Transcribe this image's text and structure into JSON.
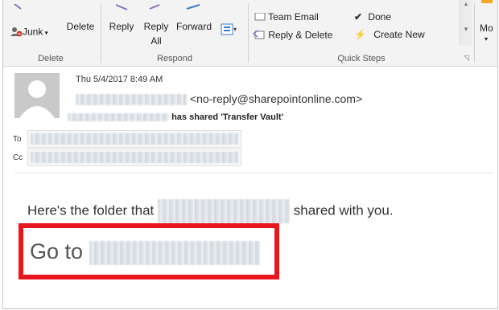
{
  "ribbon": {
    "delete_group": {
      "junk_label": "Junk",
      "delete_label": "Delete",
      "group_label": "Delete"
    },
    "respond_group": {
      "reply_label": "Reply",
      "reply_all_line1": "Reply",
      "reply_all_line2": "All",
      "forward_label": "Forward",
      "group_label": "Respond"
    },
    "quick_steps": {
      "team_email": "Team Email",
      "done": "Done",
      "reply_delete": "Reply & Delete",
      "create_new": "Create New",
      "group_label": "Quick Steps"
    },
    "move_label": "Mo"
  },
  "message": {
    "date": "Thu 5/4/2017 8:49 AM",
    "sender_email": "<no-reply@sharepointonline.com>",
    "shared_text": "has shared 'Transfer Vault'",
    "to_label": "To",
    "cc_label": "Cc",
    "body_prefix": "Here's the folder that",
    "body_suffix": "shared with you.",
    "goto_label": "Go to"
  },
  "colors": {
    "highlight": "#e8161d",
    "ribbon_bg": "#f3f3f3"
  }
}
